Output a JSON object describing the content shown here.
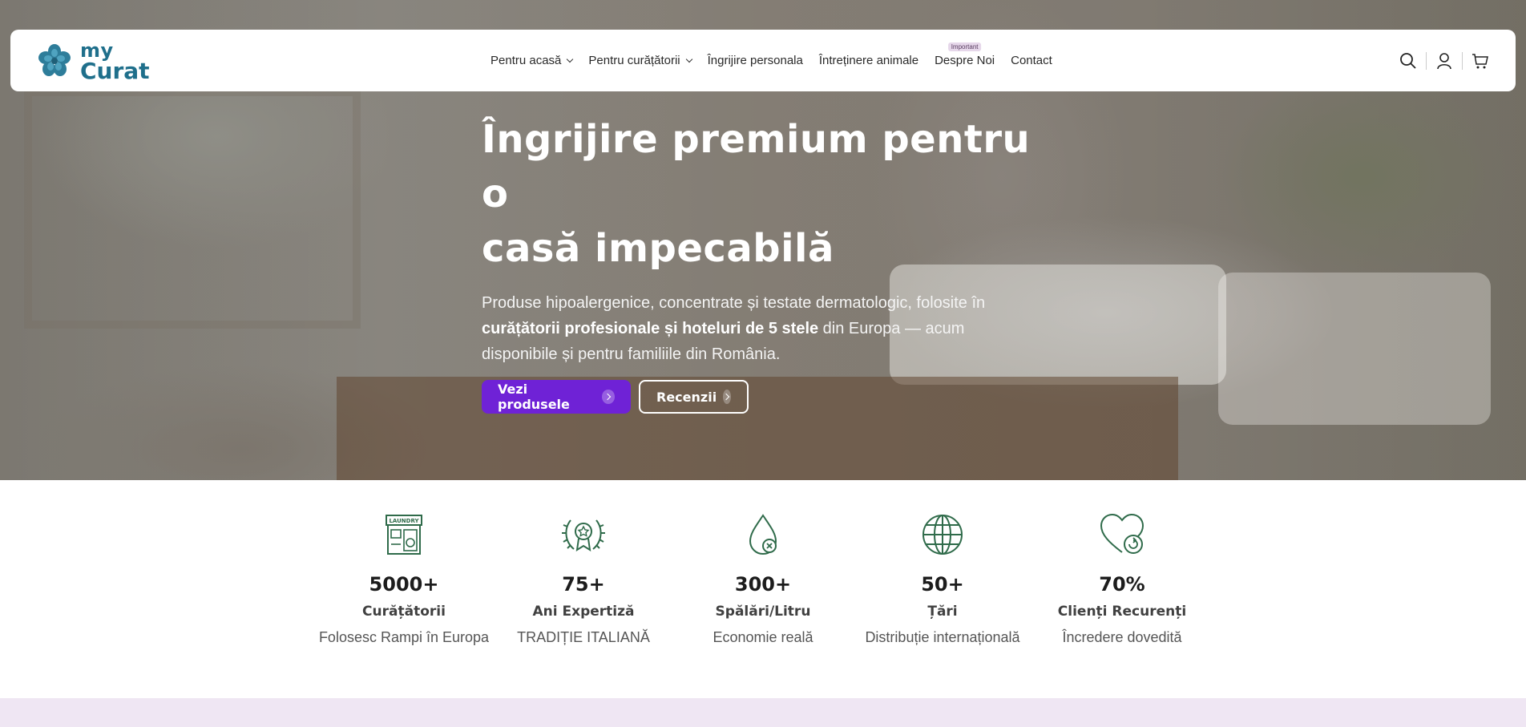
{
  "brand": {
    "logo_line1": "my",
    "logo_line2": "Curat",
    "primary_color": "#1f6f8b",
    "accent_color": "#6f22d6"
  },
  "nav": {
    "items": [
      {
        "label": "Pentru acasă",
        "has_dropdown": true
      },
      {
        "label": "Pentru curățătorii",
        "has_dropdown": true
      },
      {
        "label": "Îngrijire personala",
        "has_dropdown": false
      },
      {
        "label": "Întreținere animale",
        "has_dropdown": false
      },
      {
        "label": "Despre Noi",
        "has_dropdown": false,
        "badge": "Important"
      },
      {
        "label": "Contact",
        "has_dropdown": false
      }
    ],
    "icons": [
      "search-icon",
      "user-icon",
      "cart-icon"
    ]
  },
  "hero": {
    "title_line1": "Îngrijire premium pentru o",
    "title_line2": "casă impecabilă",
    "desc_part1": "Produse hipoalergenice, concentrate și testate dermatologic, folosite în ",
    "desc_bold": "curățătorii profesionale și hoteluri de 5 stele",
    "desc_part2": " din Europa — acum disponibile și pentru familiile din România.",
    "button_primary": "Vezi produsele",
    "button_secondary": "Recenzii"
  },
  "stats": [
    {
      "icon": "laundry-shop-icon",
      "icon_label": "LAUNDRY",
      "value": "5000+",
      "label": "Curățătorii",
      "sub": "Folosesc Rampi în Europa"
    },
    {
      "icon": "award-laurel-icon",
      "value": "75+",
      "label": "Ani Expertiză",
      "sub": "TRADIȚIE ITALIANĂ"
    },
    {
      "icon": "water-drop-icon",
      "value": "300+",
      "label": "Spălări/Litru",
      "sub": "Economie reală"
    },
    {
      "icon": "globe-icon",
      "value": "50+",
      "label": "Țări",
      "sub": "Distribuție internațională"
    },
    {
      "icon": "heart-refresh-icon",
      "value": "70%",
      "label": "Clienți Recurenți",
      "sub": "Încredere dovedită"
    }
  ]
}
